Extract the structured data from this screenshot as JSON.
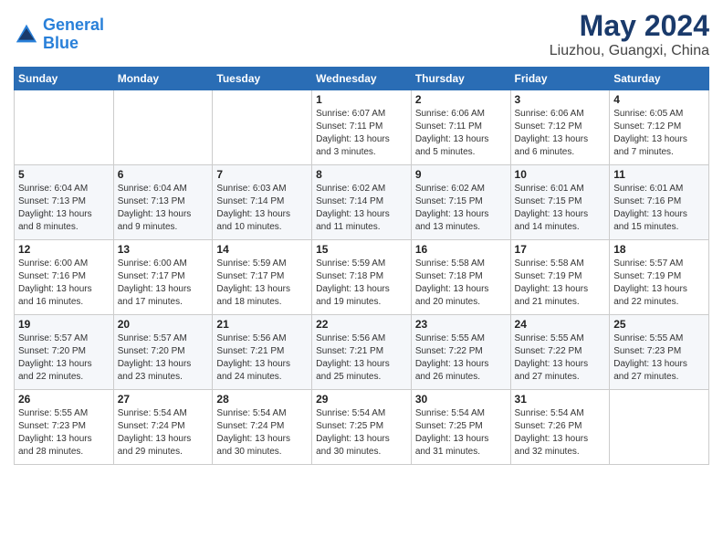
{
  "header": {
    "logo_line1": "General",
    "logo_line2": "Blue",
    "title": "May 2024",
    "subtitle": "Liuzhou, Guangxi, China"
  },
  "weekdays": [
    "Sunday",
    "Monday",
    "Tuesday",
    "Wednesday",
    "Thursday",
    "Friday",
    "Saturday"
  ],
  "weeks": [
    [
      {
        "day": "",
        "info": ""
      },
      {
        "day": "",
        "info": ""
      },
      {
        "day": "",
        "info": ""
      },
      {
        "day": "1",
        "info": "Sunrise: 6:07 AM\nSunset: 7:11 PM\nDaylight: 13 hours and 3 minutes."
      },
      {
        "day": "2",
        "info": "Sunrise: 6:06 AM\nSunset: 7:11 PM\nDaylight: 13 hours and 5 minutes."
      },
      {
        "day": "3",
        "info": "Sunrise: 6:06 AM\nSunset: 7:12 PM\nDaylight: 13 hours and 6 minutes."
      },
      {
        "day": "4",
        "info": "Sunrise: 6:05 AM\nSunset: 7:12 PM\nDaylight: 13 hours and 7 minutes."
      }
    ],
    [
      {
        "day": "5",
        "info": "Sunrise: 6:04 AM\nSunset: 7:13 PM\nDaylight: 13 hours and 8 minutes."
      },
      {
        "day": "6",
        "info": "Sunrise: 6:04 AM\nSunset: 7:13 PM\nDaylight: 13 hours and 9 minutes."
      },
      {
        "day": "7",
        "info": "Sunrise: 6:03 AM\nSunset: 7:14 PM\nDaylight: 13 hours and 10 minutes."
      },
      {
        "day": "8",
        "info": "Sunrise: 6:02 AM\nSunset: 7:14 PM\nDaylight: 13 hours and 11 minutes."
      },
      {
        "day": "9",
        "info": "Sunrise: 6:02 AM\nSunset: 7:15 PM\nDaylight: 13 hours and 13 minutes."
      },
      {
        "day": "10",
        "info": "Sunrise: 6:01 AM\nSunset: 7:15 PM\nDaylight: 13 hours and 14 minutes."
      },
      {
        "day": "11",
        "info": "Sunrise: 6:01 AM\nSunset: 7:16 PM\nDaylight: 13 hours and 15 minutes."
      }
    ],
    [
      {
        "day": "12",
        "info": "Sunrise: 6:00 AM\nSunset: 7:16 PM\nDaylight: 13 hours and 16 minutes."
      },
      {
        "day": "13",
        "info": "Sunrise: 6:00 AM\nSunset: 7:17 PM\nDaylight: 13 hours and 17 minutes."
      },
      {
        "day": "14",
        "info": "Sunrise: 5:59 AM\nSunset: 7:17 PM\nDaylight: 13 hours and 18 minutes."
      },
      {
        "day": "15",
        "info": "Sunrise: 5:59 AM\nSunset: 7:18 PM\nDaylight: 13 hours and 19 minutes."
      },
      {
        "day": "16",
        "info": "Sunrise: 5:58 AM\nSunset: 7:18 PM\nDaylight: 13 hours and 20 minutes."
      },
      {
        "day": "17",
        "info": "Sunrise: 5:58 AM\nSunset: 7:19 PM\nDaylight: 13 hours and 21 minutes."
      },
      {
        "day": "18",
        "info": "Sunrise: 5:57 AM\nSunset: 7:19 PM\nDaylight: 13 hours and 22 minutes."
      }
    ],
    [
      {
        "day": "19",
        "info": "Sunrise: 5:57 AM\nSunset: 7:20 PM\nDaylight: 13 hours and 22 minutes."
      },
      {
        "day": "20",
        "info": "Sunrise: 5:57 AM\nSunset: 7:20 PM\nDaylight: 13 hours and 23 minutes."
      },
      {
        "day": "21",
        "info": "Sunrise: 5:56 AM\nSunset: 7:21 PM\nDaylight: 13 hours and 24 minutes."
      },
      {
        "day": "22",
        "info": "Sunrise: 5:56 AM\nSunset: 7:21 PM\nDaylight: 13 hours and 25 minutes."
      },
      {
        "day": "23",
        "info": "Sunrise: 5:55 AM\nSunset: 7:22 PM\nDaylight: 13 hours and 26 minutes."
      },
      {
        "day": "24",
        "info": "Sunrise: 5:55 AM\nSunset: 7:22 PM\nDaylight: 13 hours and 27 minutes."
      },
      {
        "day": "25",
        "info": "Sunrise: 5:55 AM\nSunset: 7:23 PM\nDaylight: 13 hours and 27 minutes."
      }
    ],
    [
      {
        "day": "26",
        "info": "Sunrise: 5:55 AM\nSunset: 7:23 PM\nDaylight: 13 hours and 28 minutes."
      },
      {
        "day": "27",
        "info": "Sunrise: 5:54 AM\nSunset: 7:24 PM\nDaylight: 13 hours and 29 minutes."
      },
      {
        "day": "28",
        "info": "Sunrise: 5:54 AM\nSunset: 7:24 PM\nDaylight: 13 hours and 30 minutes."
      },
      {
        "day": "29",
        "info": "Sunrise: 5:54 AM\nSunset: 7:25 PM\nDaylight: 13 hours and 30 minutes."
      },
      {
        "day": "30",
        "info": "Sunrise: 5:54 AM\nSunset: 7:25 PM\nDaylight: 13 hours and 31 minutes."
      },
      {
        "day": "31",
        "info": "Sunrise: 5:54 AM\nSunset: 7:26 PM\nDaylight: 13 hours and 32 minutes."
      },
      {
        "day": "",
        "info": ""
      }
    ]
  ]
}
